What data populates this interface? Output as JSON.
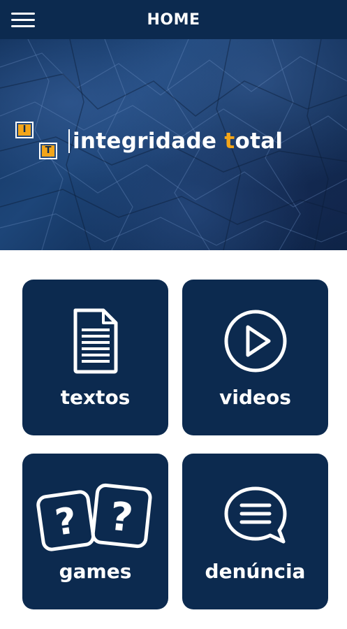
{
  "appbar": {
    "title": "HOME",
    "menu_icon": "hamburger-menu-icon"
  },
  "hero": {
    "logo_letters": [
      "I",
      "T"
    ],
    "logo_word1": "integridade",
    "logo_word2_accent": "t",
    "logo_word2_rest": "otal"
  },
  "tiles": [
    {
      "label": "textos",
      "icon": "document-icon"
    },
    {
      "label": "videos",
      "icon": "play-circle-icon"
    },
    {
      "label": "games",
      "icon": "question-dice-icon"
    },
    {
      "label": "denúncia",
      "icon": "speech-bubble-icon"
    }
  ],
  "colors": {
    "primary": "#0c2a4f",
    "accent": "#f2a51a",
    "background": "#ffffff"
  }
}
